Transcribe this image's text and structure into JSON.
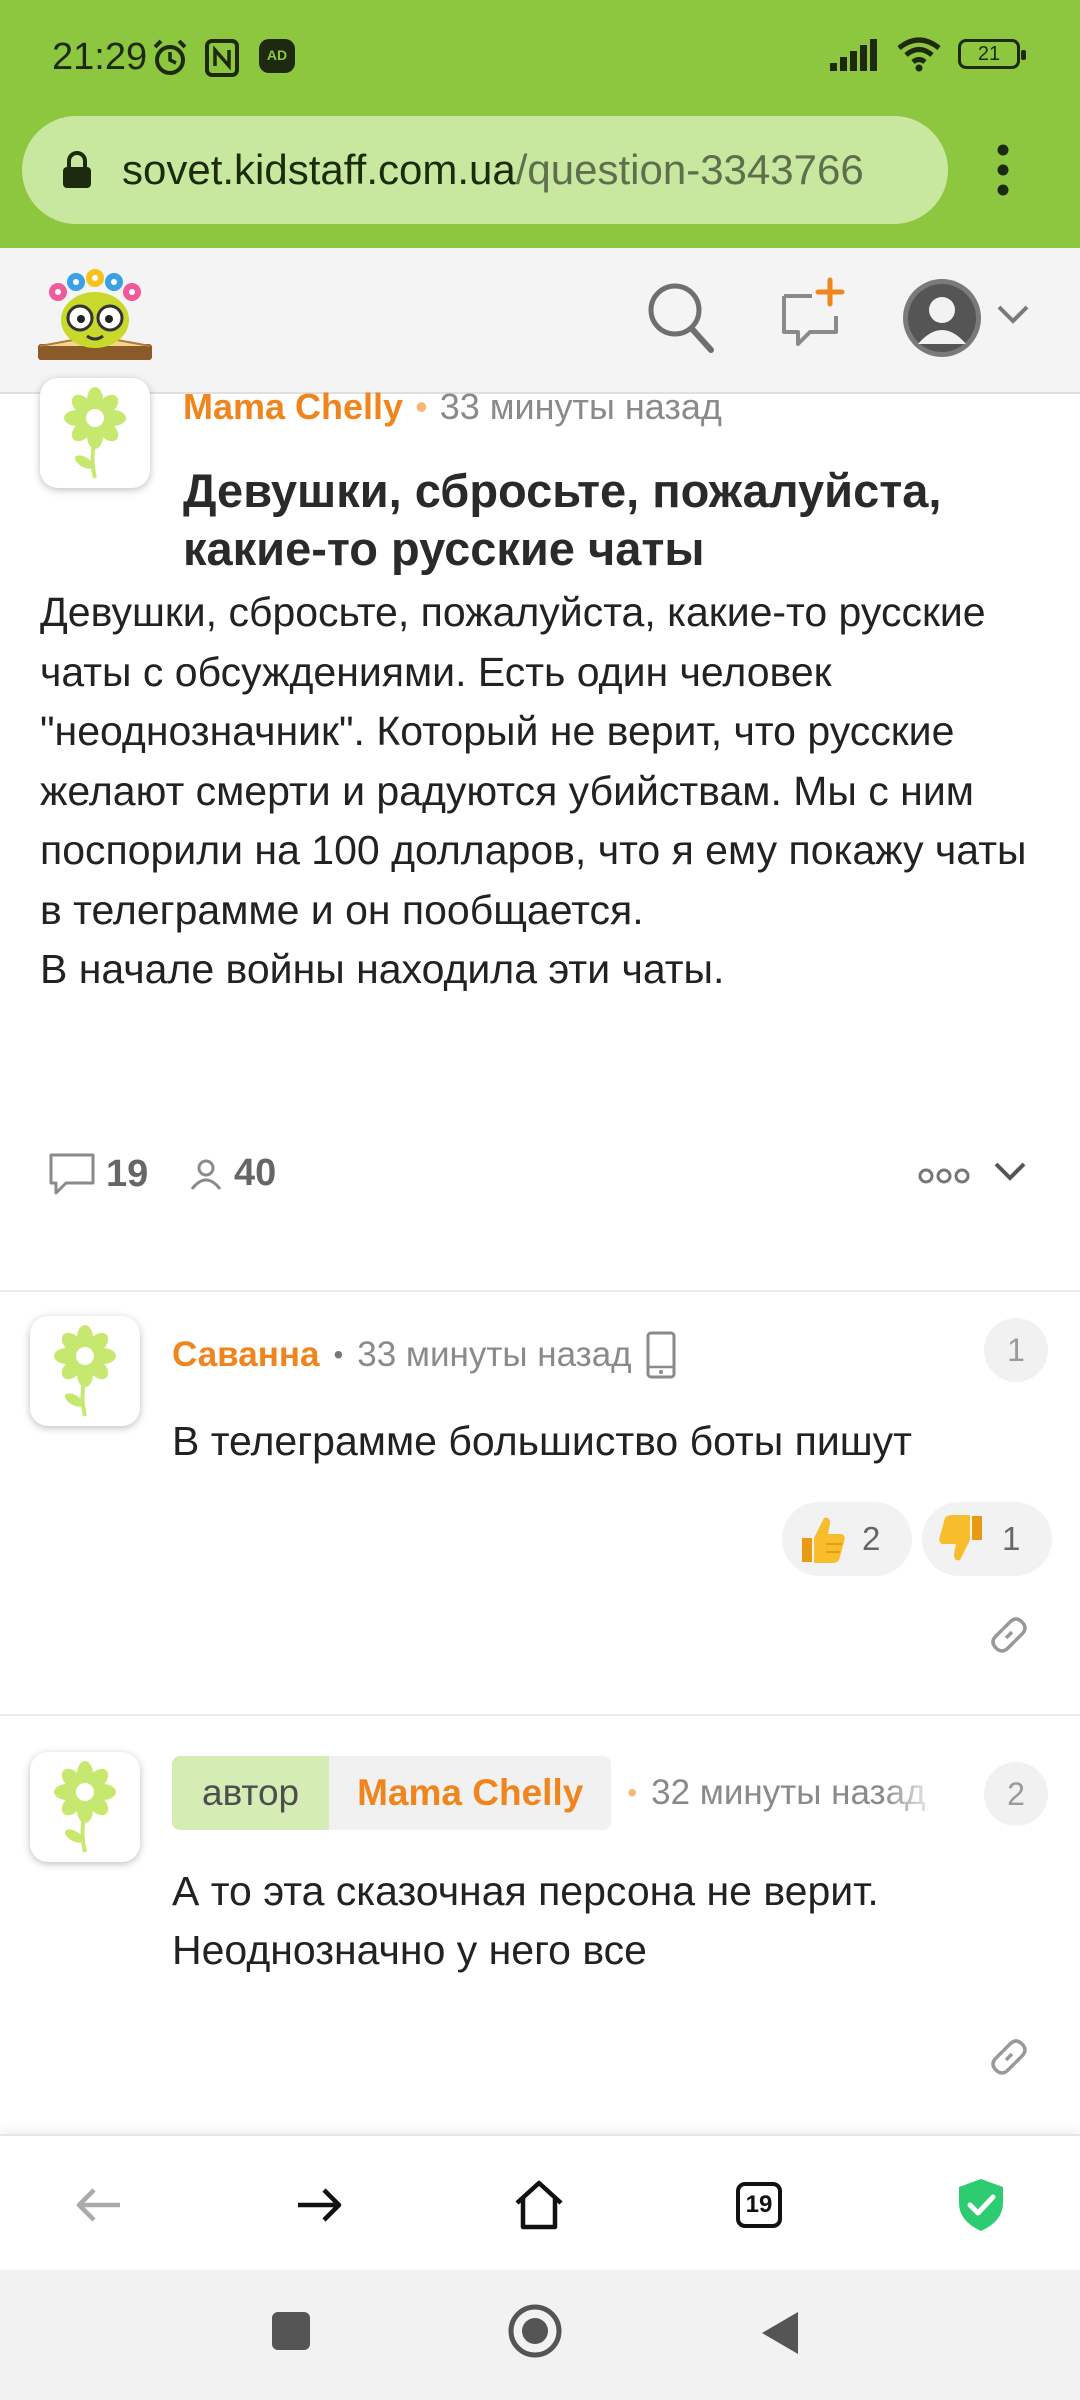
{
  "status_bar": {
    "time": "21:29",
    "battery": "21",
    "icons": [
      "alarm-icon",
      "nfc-icon",
      "ad-blocker-icon",
      "signal-icon",
      "wifi-icon",
      "battery-icon"
    ]
  },
  "browser": {
    "url_host": "sovet.kidstaff.com.ua",
    "url_path": "/question-3343766",
    "tab_count": "19"
  },
  "question": {
    "author": "Mama Chelly",
    "time": "33 минуты назад",
    "title": "Девушки, сбросьте, пожалуйста, какие-то русские чаты",
    "body": "Девушки, сбросьте, пожалуйста, какие-то русские чаты с обсуждениями. Есть один человек \"неоднозначник\". Который не верит, что русские желают смерти и радуются убийствам. Мы с ним поспорили на 100 долларов, что я ему покажу чаты в телеграмме и он пообщается.",
    "body2": "В начале войны находила эти чаты.",
    "comments_count": "19",
    "followers_count": "40"
  },
  "comments": [
    {
      "author": "Саванна",
      "time": "33 минуты назад",
      "number": "1",
      "text": "В телеграмме большиство боты пишут",
      "likes": "2",
      "dislikes": "1"
    },
    {
      "author_role": "автор",
      "author": "Mama Chelly",
      "time": "32 минуты назад",
      "number": "2",
      "text": "А то эта сказочная персона не верит. Неоднозначно у него все"
    }
  ],
  "colors": {
    "chrome_green": "#8dc63f",
    "author_orange": "#f0851e",
    "author_badge_green": "#d5ecb4",
    "shield_green": "#2ecc71"
  }
}
